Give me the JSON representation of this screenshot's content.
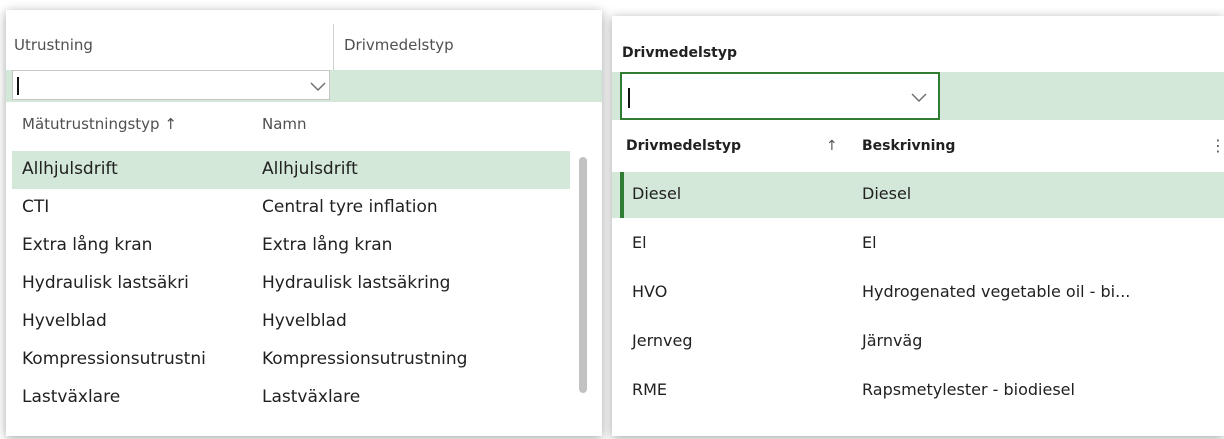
{
  "left": {
    "columns": [
      "Utrustning",
      "Drivmedelstyp"
    ],
    "dropdown": {
      "headers": [
        "Mätutrustningstyp ↑",
        "Namn"
      ],
      "rows": [
        {
          "type": "Allhjulsdrift",
          "name": "Allhjulsdrift"
        },
        {
          "type": "CTI",
          "name": "Central tyre inflation"
        },
        {
          "type": "Extra lång kran",
          "name": "Extra lång kran"
        },
        {
          "type": "Hydraulisk lastsäkri",
          "name": "Hydraulisk lastsäkring"
        },
        {
          "type": "Hyvelblad",
          "name": "Hyvelblad"
        },
        {
          "type": "Kompressionsutrustni",
          "name": "Kompressionsutrustning"
        },
        {
          "type": "Lastväxlare",
          "name": "Lastväxlare"
        }
      ]
    }
  },
  "right": {
    "title": "Drivmedelstyp",
    "headers": [
      "Drivmedelstyp",
      "↑",
      "Beskrivning"
    ],
    "rows": [
      {
        "code": "Diesel",
        "desc": "Diesel"
      },
      {
        "code": "El",
        "desc": "El"
      },
      {
        "code": "HVO",
        "desc": "Hydrogenated vegetable oil - bi..."
      },
      {
        "code": "Jernveg",
        "desc": "Järnväg"
      },
      {
        "code": "RME",
        "desc": "Rapsmetylester - biodiesel"
      }
    ]
  },
  "colors": {
    "selected_row": "#d3e8d8",
    "accent": "#2e7d32"
  }
}
